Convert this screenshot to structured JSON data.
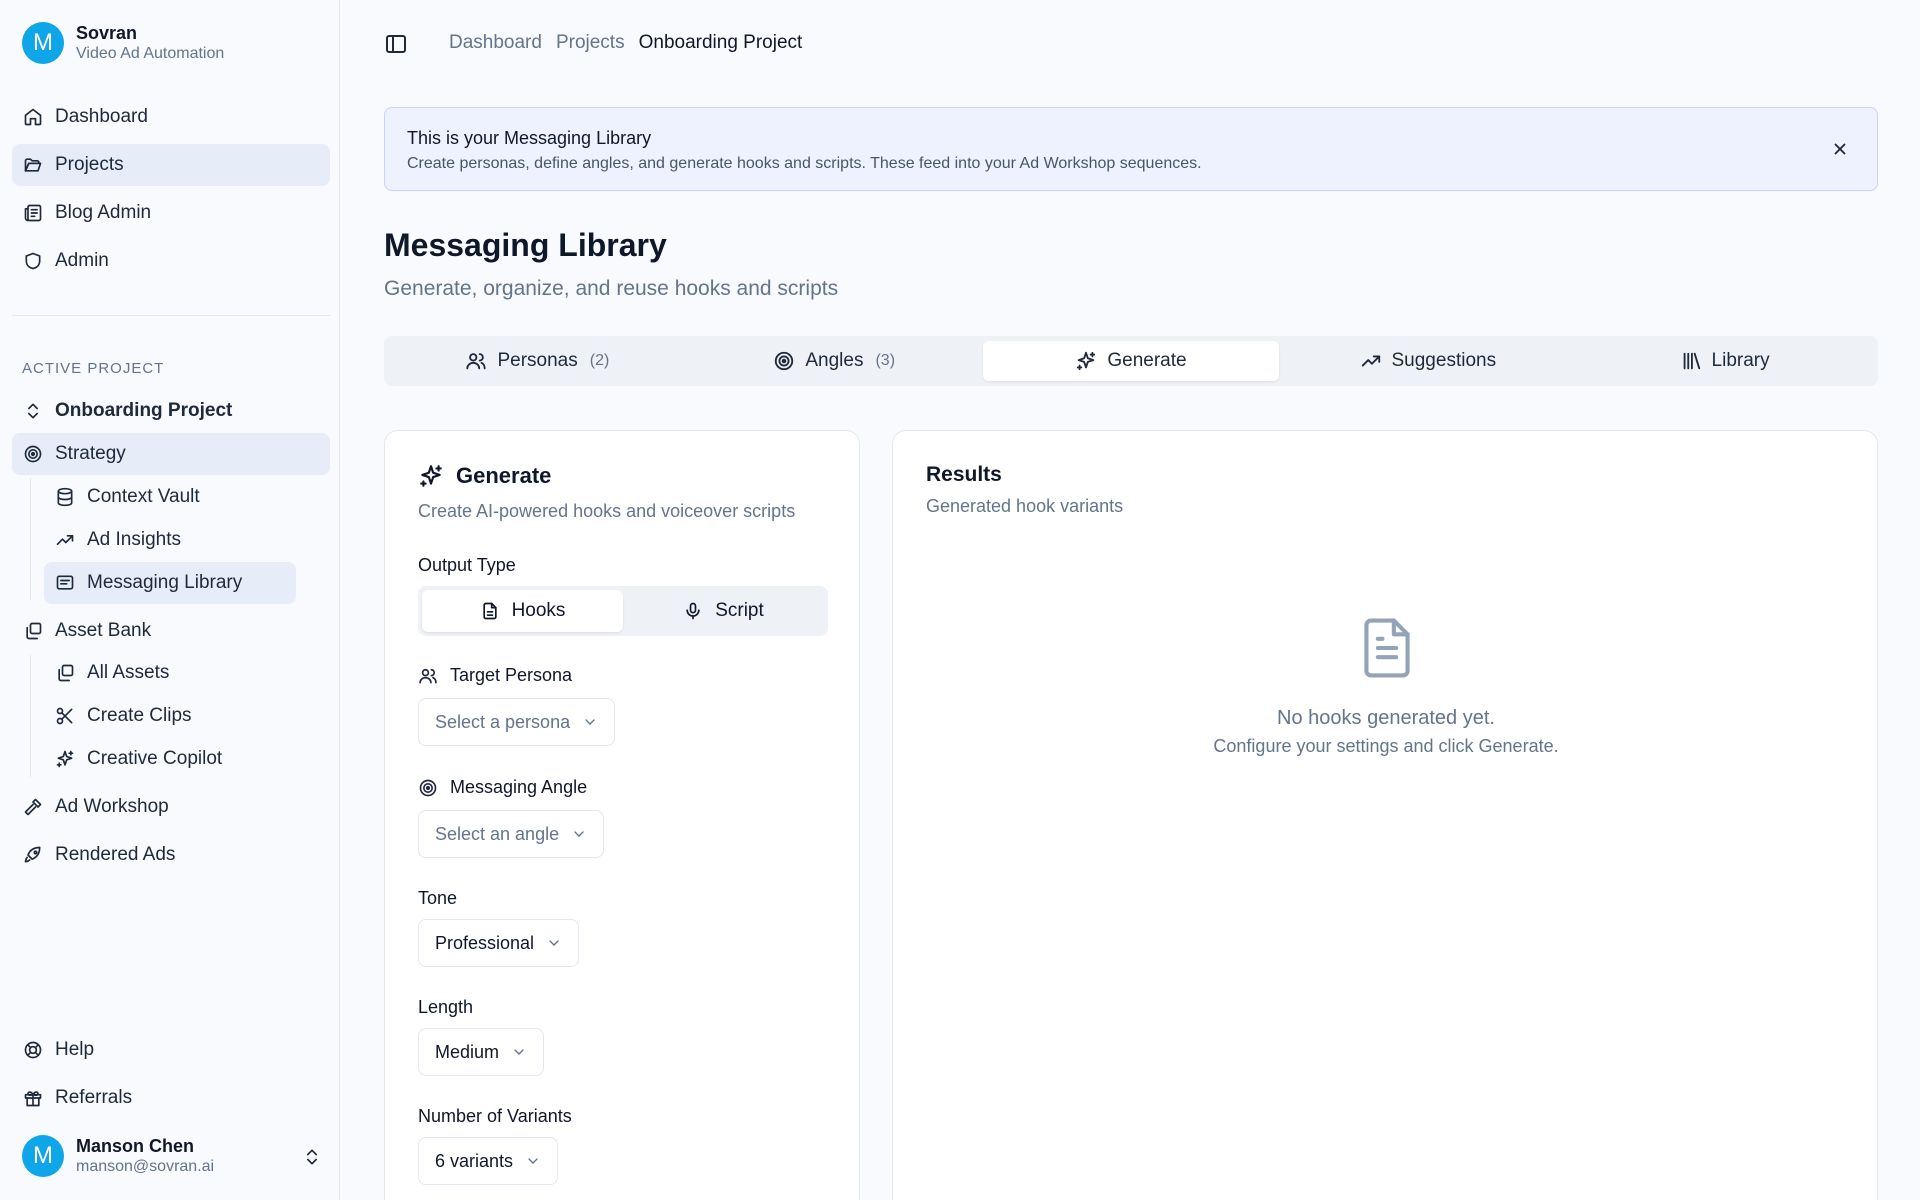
{
  "brand": {
    "initial": "M",
    "name": "Sovran",
    "subtitle": "Video Ad Automation"
  },
  "nav": {
    "dashboard": "Dashboard",
    "projects": "Projects",
    "blog_admin": "Blog Admin",
    "admin": "Admin"
  },
  "active_project": {
    "section_label": "ACTIVE PROJECT",
    "name": "Onboarding Project",
    "strategy": "Strategy",
    "context_vault": "Context Vault",
    "ad_insights": "Ad Insights",
    "messaging_library": "Messaging Library",
    "asset_bank": "Asset Bank",
    "all_assets": "All Assets",
    "create_clips": "Create Clips",
    "creative_copilot": "Creative Copilot",
    "ad_workshop": "Ad Workshop",
    "rendered_ads": "Rendered Ads"
  },
  "footer_nav": {
    "help": "Help",
    "referrals": "Referrals"
  },
  "user": {
    "initial": "M",
    "name": "Manson Chen",
    "email": "manson@sovran.ai"
  },
  "breadcrumb": [
    "Dashboard",
    "Projects",
    "Onboarding Project"
  ],
  "banner": {
    "title": "This is your Messaging Library",
    "text": "Create personas, define angles, and generate hooks and scripts. These feed into your Ad Workshop sequences."
  },
  "page": {
    "title": "Messaging Library",
    "subtitle": "Generate, organize, and reuse hooks and scripts"
  },
  "tabs": [
    {
      "label": "Personas",
      "count": "(2)"
    },
    {
      "label": "Angles",
      "count": "(3)"
    },
    {
      "label": "Generate"
    },
    {
      "label": "Suggestions"
    },
    {
      "label": "Library"
    }
  ],
  "generate": {
    "title": "Generate",
    "subtitle": "Create AI-powered hooks and voiceover scripts",
    "output_type_label": "Output Type",
    "output_hooks": "Hooks",
    "output_script": "Script",
    "persona_label": "Target Persona",
    "persona_placeholder": "Select a persona",
    "angle_label": "Messaging Angle",
    "angle_placeholder": "Select an angle",
    "tone_label": "Tone",
    "tone_value": "Professional",
    "length_label": "Length",
    "length_value": "Medium",
    "variants_label": "Number of Variants",
    "variants_value": "6 variants"
  },
  "results": {
    "title": "Results",
    "subtitle": "Generated hook variants",
    "empty_title": "No hooks generated yet.",
    "empty_text": "Configure your settings and click Generate."
  },
  "colors": {
    "accent": "#0ea5e9",
    "active_bg": "#e6edf8",
    "banner_bg": "#eef2ff"
  }
}
